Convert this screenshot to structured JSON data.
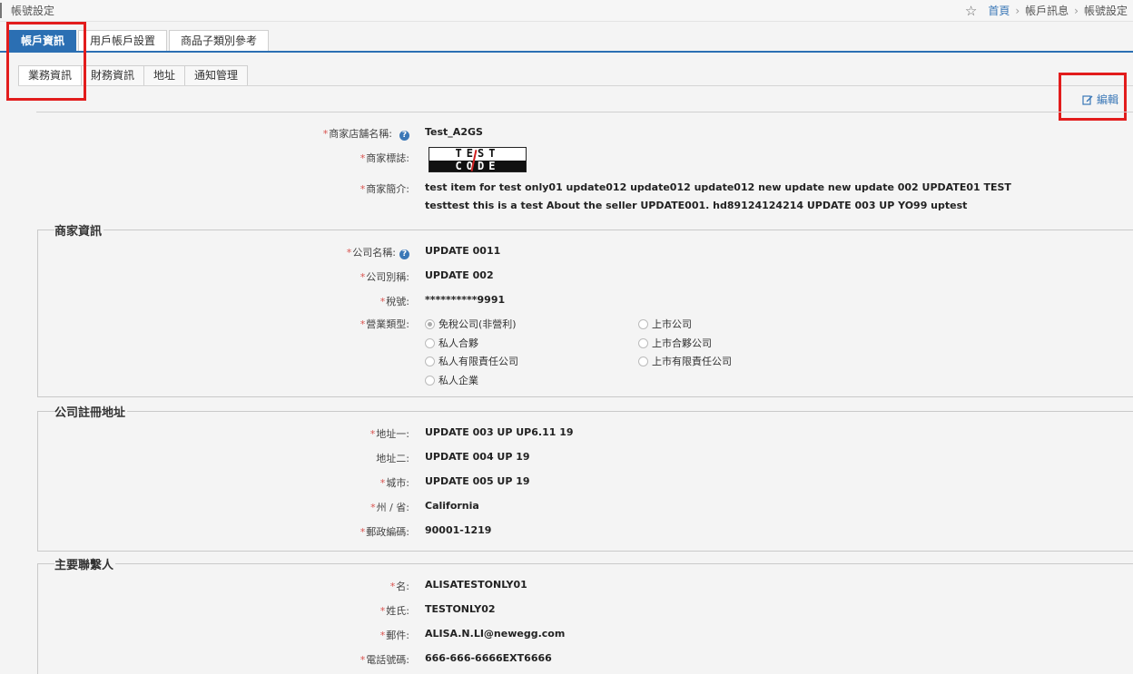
{
  "header": {
    "page_name": "帳號設定",
    "breadcrumb": {
      "home": "首頁",
      "level1": "帳戶訊息",
      "level2": "帳號設定",
      "sep": "›"
    }
  },
  "main_tabs": [
    {
      "label": "帳戶資訊",
      "active": true
    },
    {
      "label": "用戶帳戶設置",
      "active": false
    },
    {
      "label": "商品子類別參考",
      "active": false
    }
  ],
  "sub_tabs": [
    {
      "label": "業務資訊",
      "active": true
    },
    {
      "label": "財務資訊",
      "active": false
    },
    {
      "label": "地址",
      "active": false
    },
    {
      "label": "通知管理",
      "active": false
    }
  ],
  "edit_label": "編輯",
  "store": {
    "name_label": "商家店舖名稱:",
    "name": "Test_A2GS",
    "logo_label": "商家標誌:",
    "logo_text_top": "TEST",
    "logo_text_bottom": "CODE",
    "intro_label": "商家簡介:",
    "intro_line1": "test item for test only01 update012 update012 update012 new update new update 002 UPDATE01 TEST",
    "intro_line2": "testtest this is a test About the seller UPDATE001. hd89124124214 UPDATE 003 UP YO99 uptest"
  },
  "company": {
    "legend": "商家資訊",
    "name_label": "公司名稱:",
    "name": "UPDATE 0011",
    "alias_label": "公司別稱:",
    "alias": "UPDATE 002",
    "tax_label": "稅號:",
    "tax": "**********9991",
    "type_label": "營業類型:",
    "types": [
      {
        "label": "免稅公司(非營利)",
        "checked": true
      },
      {
        "label": "私人合夥",
        "checked": false
      },
      {
        "label": "私人有限責任公司",
        "checked": false
      },
      {
        "label": "私人企業",
        "checked": false
      },
      {
        "label": "上市公司",
        "checked": false
      },
      {
        "label": "上市合夥公司",
        "checked": false
      },
      {
        "label": "上市有限責任公司",
        "checked": false
      }
    ]
  },
  "address": {
    "legend": "公司註冊地址",
    "line1_label": "地址一:",
    "line1": "UPDATE 003 UP UP6.11 19",
    "line2_label": "地址二:",
    "line2": "UPDATE 004 UP 19",
    "city_label": "城市:",
    "city": "UPDATE 005 UP 19",
    "state_label": "州 / 省:",
    "state": "California",
    "zip_label": "郵政編碼:",
    "zip": "90001-1219"
  },
  "contact": {
    "legend": "主要聯繫人",
    "first_label": "名:",
    "first": "ALISATESTONLY01",
    "last_label": "姓氏:",
    "last": "TESTONLY02",
    "email_label": "郵件:",
    "email": "ALISA.N.LI@newegg.com",
    "phone_label": "電話號碼:",
    "phone": "666-666-6666EXT6666"
  },
  "required_mark": "*"
}
